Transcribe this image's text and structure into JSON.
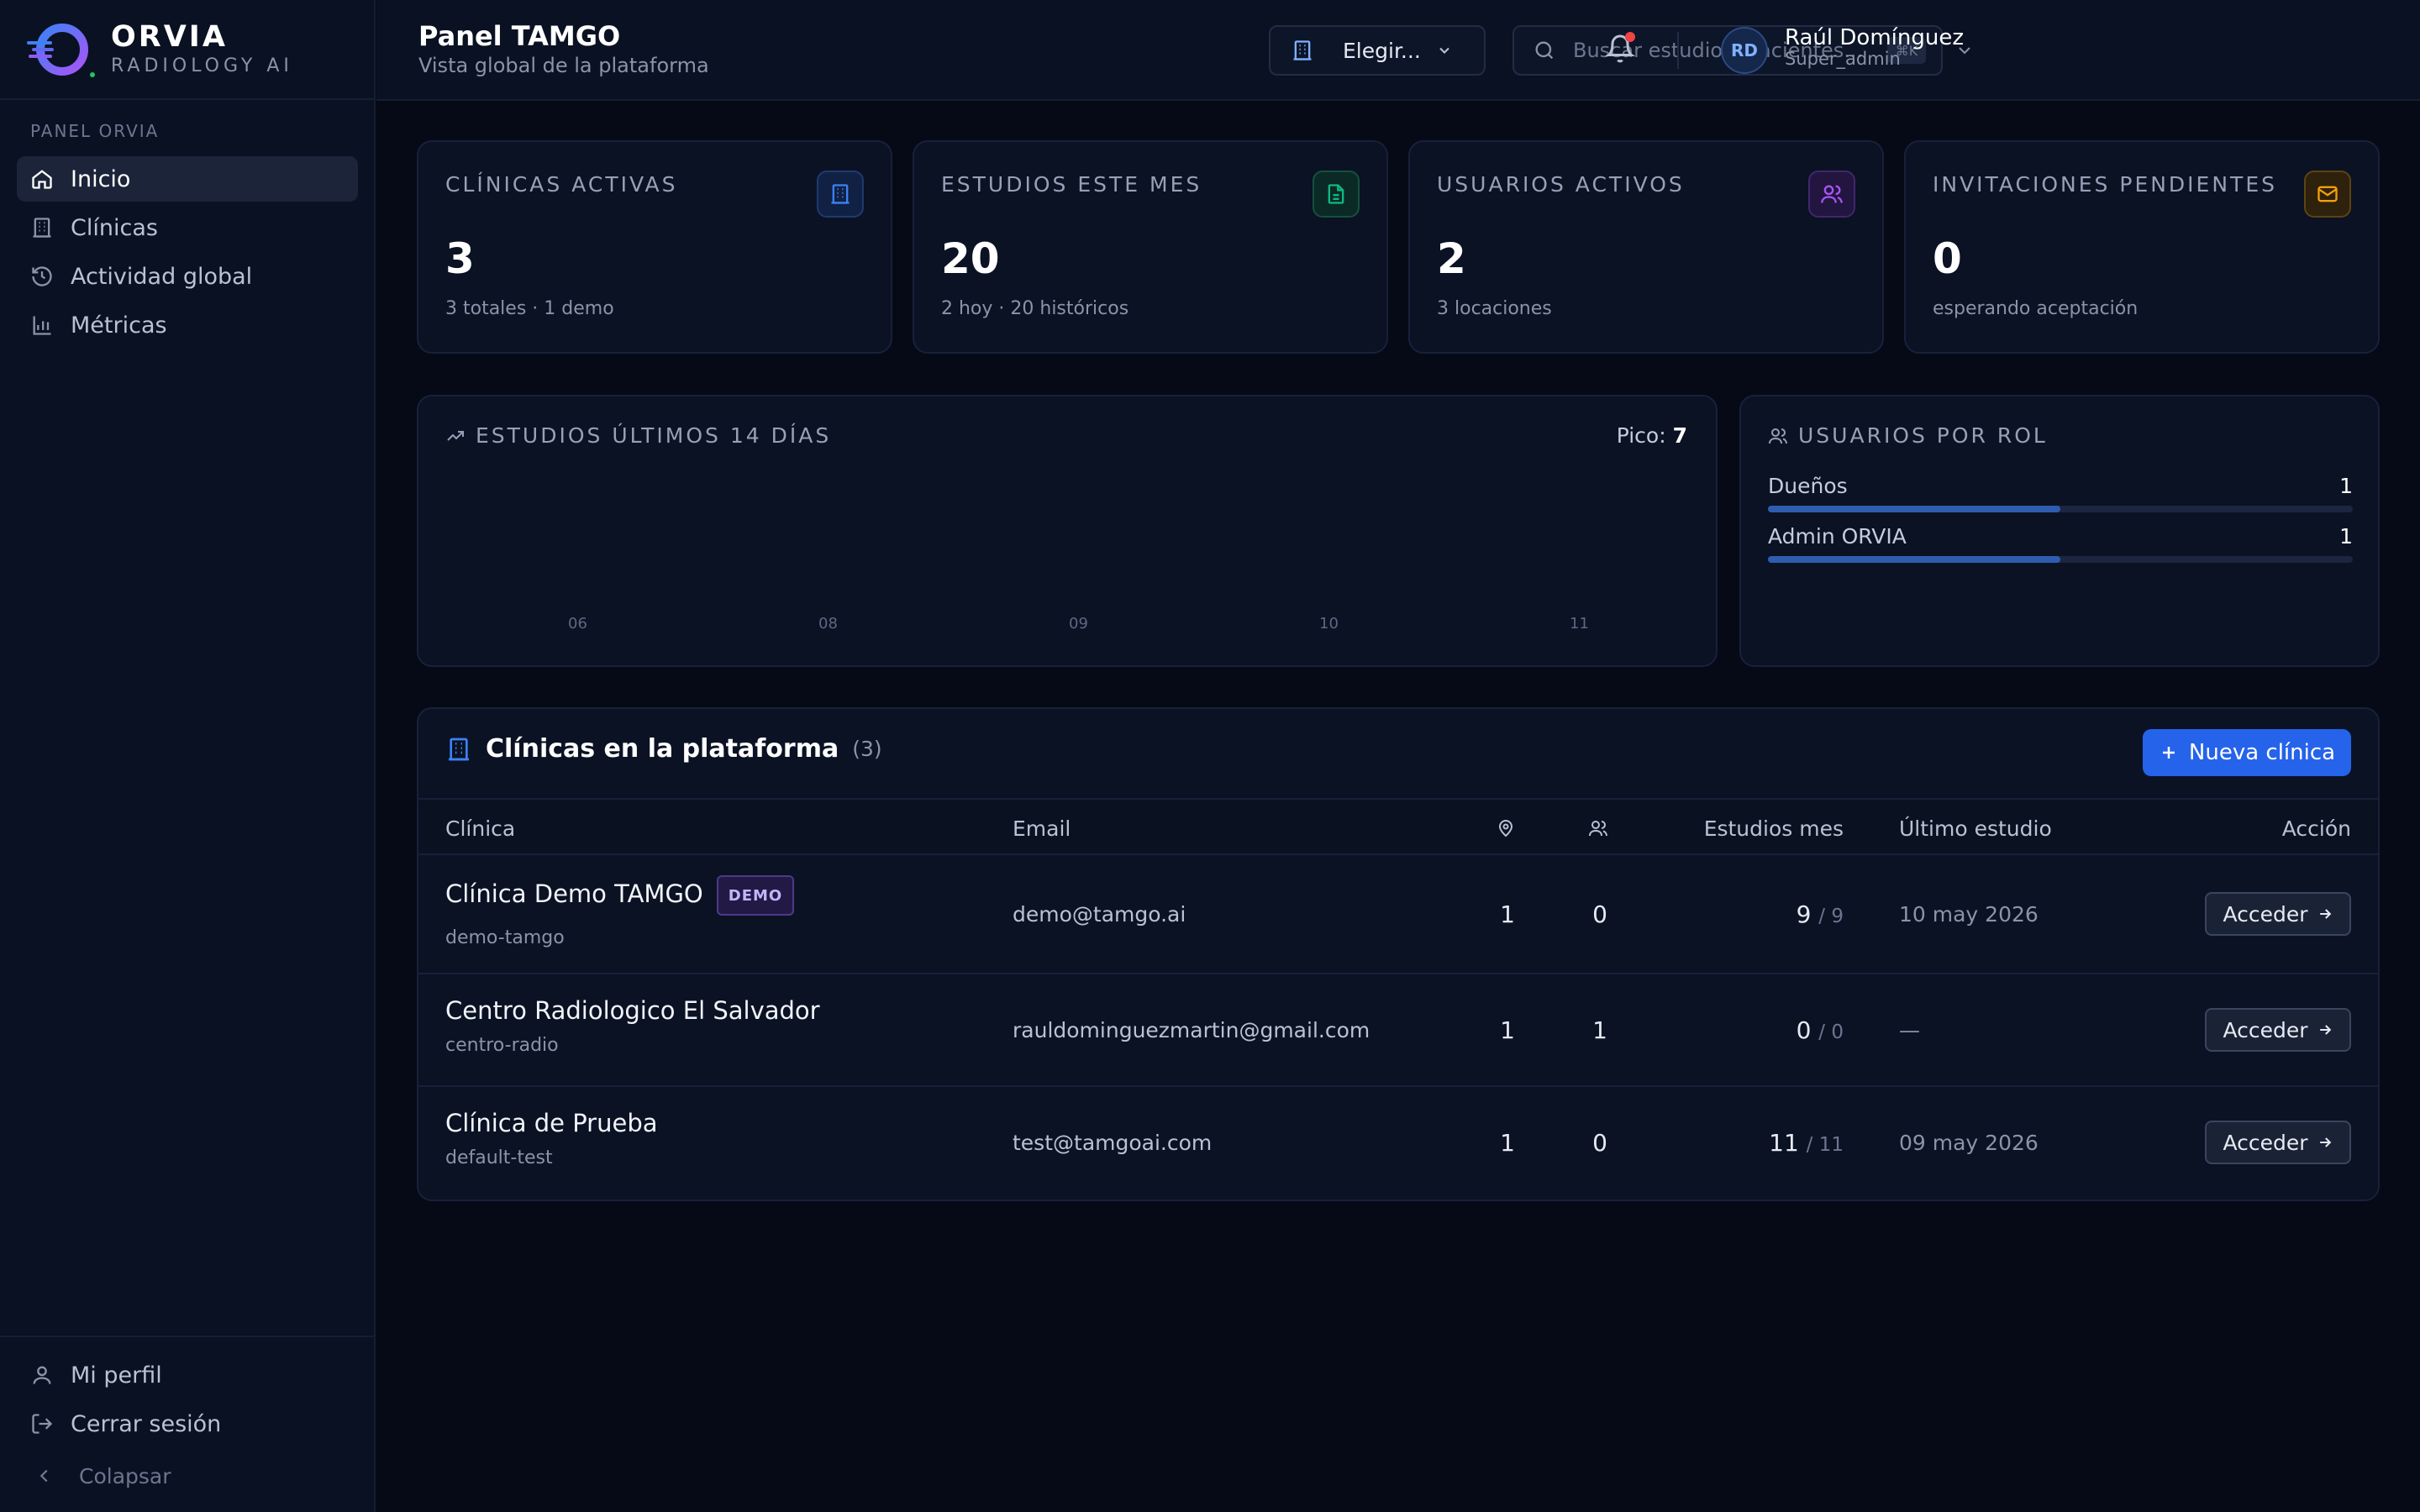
{
  "brand": {
    "name": "ORVIA",
    "tagline": "RADIOLOGY AI"
  },
  "sidebar": {
    "section_label": "PANEL ORVIA",
    "items": [
      {
        "label": "Inicio",
        "icon": "home-icon",
        "active": true
      },
      {
        "label": "Clínicas",
        "icon": "building-icon"
      },
      {
        "label": "Actividad global",
        "icon": "history-icon"
      },
      {
        "label": "Métricas",
        "icon": "bar-chart-icon"
      }
    ],
    "bottom": {
      "profile": "Mi perfil",
      "logout": "Cerrar sesión",
      "collapse": "Colapsar"
    }
  },
  "header": {
    "title": "Panel TAMGO",
    "subtitle": "Vista global de la plataforma",
    "clinic_select": "Elegir...",
    "search_placeholder": "Buscar estudios, pacientes...",
    "search_shortcut": "⌘K",
    "user": {
      "initials": "RD",
      "name": "Raúl Domínguez",
      "role": "Super_admin"
    }
  },
  "stats": [
    {
      "label": "CLÍNICAS ACTIVAS",
      "value": "3",
      "sub": "3 totales · 1 demo",
      "icon": "building-icon",
      "color": "#3b82f6"
    },
    {
      "label": "ESTUDIOS ESTE MES",
      "value": "20",
      "sub": "2 hoy · 20 históricos",
      "icon": "document-icon",
      "color": "#10b981"
    },
    {
      "label": "USUARIOS ACTIVOS",
      "value": "2",
      "sub": "3 locaciones",
      "icon": "users-icon",
      "color": "#a855f7"
    },
    {
      "label": "INVITACIONES PENDIENTES",
      "value": "0",
      "sub": "esperando aceptación",
      "icon": "mail-icon",
      "color": "#f59e0b"
    }
  ],
  "studies_chart": {
    "title": "ESTUDIOS ÚLTIMOS 14 DÍAS",
    "peak_label": "Pico:",
    "peak_value": "7",
    "chart_data": {
      "type": "bar",
      "categories": [
        "06",
        "08",
        "09",
        "10",
        "11"
      ],
      "values": [],
      "title": "ESTUDIOS ÚLTIMOS 14 DÍAS"
    }
  },
  "roles": {
    "title": "USUARIOS POR ROL",
    "items": [
      {
        "name": "Dueños",
        "count": "1",
        "fraction": 0.5
      },
      {
        "name": "Admin ORVIA",
        "count": "1",
        "fraction": 0.5
      }
    ]
  },
  "clinics": {
    "title": "Clínicas en la plataforma",
    "count": "(3)",
    "new_button": "Nueva clínica",
    "columns": {
      "clinic": "Clínica",
      "email": "Email",
      "studies": "Estudios mes",
      "last": "Último estudio",
      "action": "Acción"
    },
    "rows": [
      {
        "name": "Clínica Demo TAMGO",
        "badge": "DEMO",
        "slug": "demo-tamgo",
        "email": "demo@tamgo.ai",
        "locations": "1",
        "users": "0",
        "studies": "9",
        "studies_total": "/ 9",
        "last": "10 may 2026",
        "action": "Acceder"
      },
      {
        "name": "Centro Radiologico El Salvador",
        "badge": "",
        "slug": "centro-radio",
        "email": "rauldominguezmartin@gmail.com",
        "locations": "1",
        "users": "1",
        "studies": "0",
        "studies_total": "/ 0",
        "last": "—",
        "action": "Acceder"
      },
      {
        "name": "Clínica de Prueba",
        "badge": "",
        "slug": "default-test",
        "email": "test@tamgoai.com",
        "locations": "1",
        "users": "0",
        "studies": "11",
        "studies_total": "/ 11",
        "last": "09 may 2026",
        "action": "Acceder"
      }
    ]
  }
}
